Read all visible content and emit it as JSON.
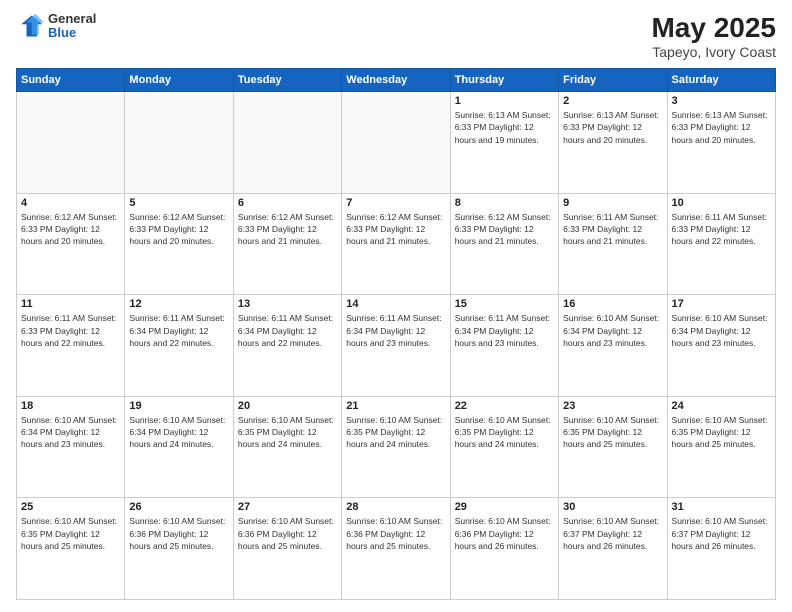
{
  "header": {
    "logo_line1": "General",
    "logo_line2": "Blue",
    "title": "May 2025",
    "subtitle": "Tapeyo, Ivory Coast"
  },
  "days_of_week": [
    "Sunday",
    "Monday",
    "Tuesday",
    "Wednesday",
    "Thursday",
    "Friday",
    "Saturday"
  ],
  "weeks": [
    [
      {
        "day": "",
        "info": ""
      },
      {
        "day": "",
        "info": ""
      },
      {
        "day": "",
        "info": ""
      },
      {
        "day": "",
        "info": ""
      },
      {
        "day": "1",
        "info": "Sunrise: 6:13 AM\nSunset: 6:33 PM\nDaylight: 12 hours\nand 19 minutes."
      },
      {
        "day": "2",
        "info": "Sunrise: 6:13 AM\nSunset: 6:33 PM\nDaylight: 12 hours\nand 20 minutes."
      },
      {
        "day": "3",
        "info": "Sunrise: 6:13 AM\nSunset: 6:33 PM\nDaylight: 12 hours\nand 20 minutes."
      }
    ],
    [
      {
        "day": "4",
        "info": "Sunrise: 6:12 AM\nSunset: 6:33 PM\nDaylight: 12 hours\nand 20 minutes."
      },
      {
        "day": "5",
        "info": "Sunrise: 6:12 AM\nSunset: 6:33 PM\nDaylight: 12 hours\nand 20 minutes."
      },
      {
        "day": "6",
        "info": "Sunrise: 6:12 AM\nSunset: 6:33 PM\nDaylight: 12 hours\nand 21 minutes."
      },
      {
        "day": "7",
        "info": "Sunrise: 6:12 AM\nSunset: 6:33 PM\nDaylight: 12 hours\nand 21 minutes."
      },
      {
        "day": "8",
        "info": "Sunrise: 6:12 AM\nSunset: 6:33 PM\nDaylight: 12 hours\nand 21 minutes."
      },
      {
        "day": "9",
        "info": "Sunrise: 6:11 AM\nSunset: 6:33 PM\nDaylight: 12 hours\nand 21 minutes."
      },
      {
        "day": "10",
        "info": "Sunrise: 6:11 AM\nSunset: 6:33 PM\nDaylight: 12 hours\nand 22 minutes."
      }
    ],
    [
      {
        "day": "11",
        "info": "Sunrise: 6:11 AM\nSunset: 6:33 PM\nDaylight: 12 hours\nand 22 minutes."
      },
      {
        "day": "12",
        "info": "Sunrise: 6:11 AM\nSunset: 6:34 PM\nDaylight: 12 hours\nand 22 minutes."
      },
      {
        "day": "13",
        "info": "Sunrise: 6:11 AM\nSunset: 6:34 PM\nDaylight: 12 hours\nand 22 minutes."
      },
      {
        "day": "14",
        "info": "Sunrise: 6:11 AM\nSunset: 6:34 PM\nDaylight: 12 hours\nand 23 minutes."
      },
      {
        "day": "15",
        "info": "Sunrise: 6:11 AM\nSunset: 6:34 PM\nDaylight: 12 hours\nand 23 minutes."
      },
      {
        "day": "16",
        "info": "Sunrise: 6:10 AM\nSunset: 6:34 PM\nDaylight: 12 hours\nand 23 minutes."
      },
      {
        "day": "17",
        "info": "Sunrise: 6:10 AM\nSunset: 6:34 PM\nDaylight: 12 hours\nand 23 minutes."
      }
    ],
    [
      {
        "day": "18",
        "info": "Sunrise: 6:10 AM\nSunset: 6:34 PM\nDaylight: 12 hours\nand 23 minutes."
      },
      {
        "day": "19",
        "info": "Sunrise: 6:10 AM\nSunset: 6:34 PM\nDaylight: 12 hours\nand 24 minutes."
      },
      {
        "day": "20",
        "info": "Sunrise: 6:10 AM\nSunset: 6:35 PM\nDaylight: 12 hours\nand 24 minutes."
      },
      {
        "day": "21",
        "info": "Sunrise: 6:10 AM\nSunset: 6:35 PM\nDaylight: 12 hours\nand 24 minutes."
      },
      {
        "day": "22",
        "info": "Sunrise: 6:10 AM\nSunset: 6:35 PM\nDaylight: 12 hours\nand 24 minutes."
      },
      {
        "day": "23",
        "info": "Sunrise: 6:10 AM\nSunset: 6:35 PM\nDaylight: 12 hours\nand 25 minutes."
      },
      {
        "day": "24",
        "info": "Sunrise: 6:10 AM\nSunset: 6:35 PM\nDaylight: 12 hours\nand 25 minutes."
      }
    ],
    [
      {
        "day": "25",
        "info": "Sunrise: 6:10 AM\nSunset: 6:35 PM\nDaylight: 12 hours\nand 25 minutes."
      },
      {
        "day": "26",
        "info": "Sunrise: 6:10 AM\nSunset: 6:36 PM\nDaylight: 12 hours\nand 25 minutes."
      },
      {
        "day": "27",
        "info": "Sunrise: 6:10 AM\nSunset: 6:36 PM\nDaylight: 12 hours\nand 25 minutes."
      },
      {
        "day": "28",
        "info": "Sunrise: 6:10 AM\nSunset: 6:36 PM\nDaylight: 12 hours\nand 25 minutes."
      },
      {
        "day": "29",
        "info": "Sunrise: 6:10 AM\nSunset: 6:36 PM\nDaylight: 12 hours\nand 26 minutes."
      },
      {
        "day": "30",
        "info": "Sunrise: 6:10 AM\nSunset: 6:37 PM\nDaylight: 12 hours\nand 26 minutes."
      },
      {
        "day": "31",
        "info": "Sunrise: 6:10 AM\nSunset: 6:37 PM\nDaylight: 12 hours\nand 26 minutes."
      }
    ]
  ]
}
